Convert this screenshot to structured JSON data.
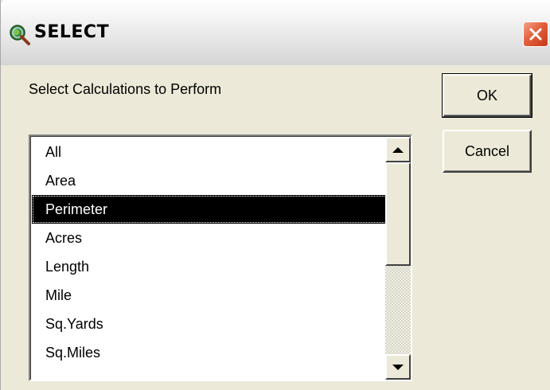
{
  "window": {
    "title": "SELECT",
    "close_icon": "close-icon",
    "app_icon": "globe-magnifier-icon"
  },
  "dialog": {
    "prompt": "Select Calculations to Perform",
    "ok_label": "OK",
    "cancel_label": "Cancel"
  },
  "list": {
    "items": [
      {
        "label": "All",
        "selected": false
      },
      {
        "label": "Area",
        "selected": false
      },
      {
        "label": "Perimeter",
        "selected": true
      },
      {
        "label": "Acres",
        "selected": false
      },
      {
        "label": "Length",
        "selected": false
      },
      {
        "label": "Mile",
        "selected": false
      },
      {
        "label": "Sq.Yards",
        "selected": false
      },
      {
        "label": "Sq.Miles",
        "selected": false
      }
    ]
  },
  "colors": {
    "close_button": "#e2603c",
    "selection_bg": "#000000",
    "window_bg": "#ece9d8"
  }
}
